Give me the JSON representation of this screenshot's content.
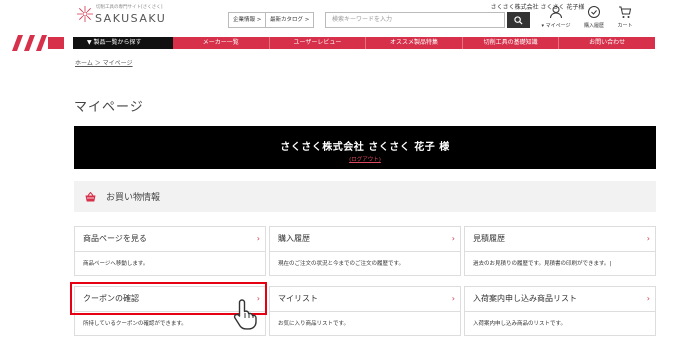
{
  "header": {
    "user_top": "さくさく株式会社 さくさく 花子様",
    "logo_tag": "切削工具の専門サイト[さくさく]",
    "logo_name": "SAKUSAKU",
    "buttons": [
      "企業情報 >",
      "最新カタログ >"
    ],
    "search_placeholder": "検索キーワードを入力",
    "icons": [
      {
        "name": "user-icon",
        "label": "▾ マイページ"
      },
      {
        "name": "history-icon",
        "label": "購入履歴"
      },
      {
        "name": "cart-icon",
        "label": "カート"
      }
    ]
  },
  "nav": {
    "products": "▼ 製品一覧から探す",
    "items": [
      "メーカー一覧",
      "ユーザーレビュー",
      "オススメ製品特集",
      "切削工具の基礎知識",
      "お問い合わせ"
    ]
  },
  "breadcrumb": "ホーム ＞ マイページ",
  "page_title": "マイページ",
  "banner": {
    "name": "さくさく株式会社 さくさく 花子 様",
    "logout": "(ログアウト)"
  },
  "section": {
    "title": "お買い物情報"
  },
  "cards": [
    {
      "title": "商品ページを見る",
      "desc": "商品ページへ移動します。"
    },
    {
      "title": "購入履歴",
      "desc": "現在のご注文の状況と今までのご注文の履歴です。"
    },
    {
      "title": "見積履歴",
      "desc": "過去のお見積りの履歴です。見積書の印刷ができます。|"
    },
    {
      "title": "クーポンの確認",
      "desc": "所持しているクーポンの確認ができます。"
    },
    {
      "title": "マイリスト",
      "desc": "お気に入り商品リストです。"
    },
    {
      "title": "入荷案内申し込み商品リスト",
      "desc": "入荷案内申し込み商品のリストです。"
    }
  ],
  "chevron": "›",
  "colors": {
    "accent": "#d6304a",
    "highlight": "#e60012",
    "banner": "#000000"
  }
}
